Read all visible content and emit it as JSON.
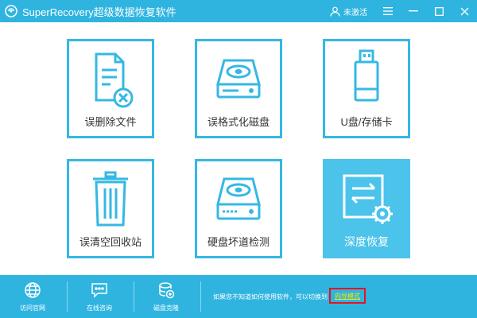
{
  "window": {
    "title": "SuperRecovery超级数据恢复软件",
    "user_status": "未激活",
    "icons": {
      "logo": "app-logo-icon",
      "user": "user-icon",
      "menu": "menu-icon",
      "minimize": "minimize-icon",
      "maximize": "maximize-icon",
      "close": "close-icon"
    }
  },
  "tiles": [
    {
      "label": "误删除文件",
      "icon": "deleted-file-icon"
    },
    {
      "label": "误格式化磁盘",
      "icon": "hard-disk-icon"
    },
    {
      "label": "U盘/存储卡",
      "icon": "usb-drive-icon"
    },
    {
      "label": "误清空回收站",
      "icon": "recycle-bin-icon"
    },
    {
      "label": "硬盘坏道检测",
      "icon": "disk-check-icon"
    },
    {
      "label": "深度恢复",
      "icon": "deep-recovery-icon",
      "highlighted": true
    }
  ],
  "footer": {
    "items": [
      {
        "label": "访问官网",
        "icon": "globe-icon"
      },
      {
        "label": "在线咨询",
        "icon": "chat-icon"
      },
      {
        "label": "磁盘克隆",
        "icon": "disk-clone-icon"
      }
    ],
    "hint": "如果您不知道如何使用软件，可以切换到",
    "guide_link": "向导模式"
  },
  "colors": {
    "primary": "#2fb4e0",
    "tile_border": "#35b8e3",
    "tile_highlight": "#4bc3ea",
    "link": "#ffe600",
    "link_outline": "#e8131c"
  }
}
